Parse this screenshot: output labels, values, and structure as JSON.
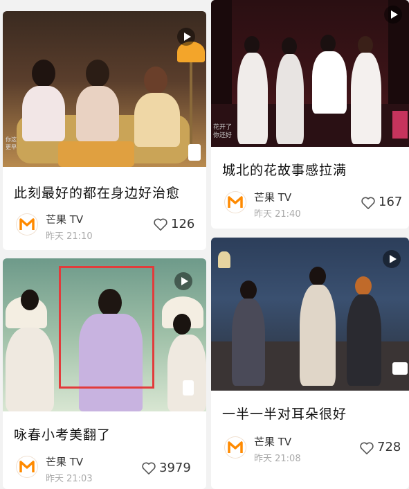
{
  "cards": [
    {
      "title": "此刻最好的都在身边好治愈",
      "author": "芒果 TV",
      "time": "昨天 21:10",
      "likes": "126"
    },
    {
      "title": "城北的花故事感拉满",
      "author": "芒果 TV",
      "time": "昨天 21:40",
      "likes": "167"
    },
    {
      "title": "咏春小考美翻了",
      "author": "芒果 TV",
      "time": "昨天 21:03",
      "likes": "3979"
    },
    {
      "title": "一半一半对耳朵很好",
      "author": "芒果 TV",
      "time": "昨天 21:08",
      "likes": "728"
    }
  ],
  "overlays": {
    "card1_caption_1": "你这",
    "card1_caption_2": "更早",
    "card2_caption_1": "花开了",
    "card2_caption_2": "你还好"
  },
  "colors": {
    "brand_orange": "#ff8a00",
    "highlight_red": "#e23b3b"
  },
  "icons": {
    "play": "play-icon",
    "heart": "heart-outline-icon",
    "logo": "mango-tv-logo"
  }
}
